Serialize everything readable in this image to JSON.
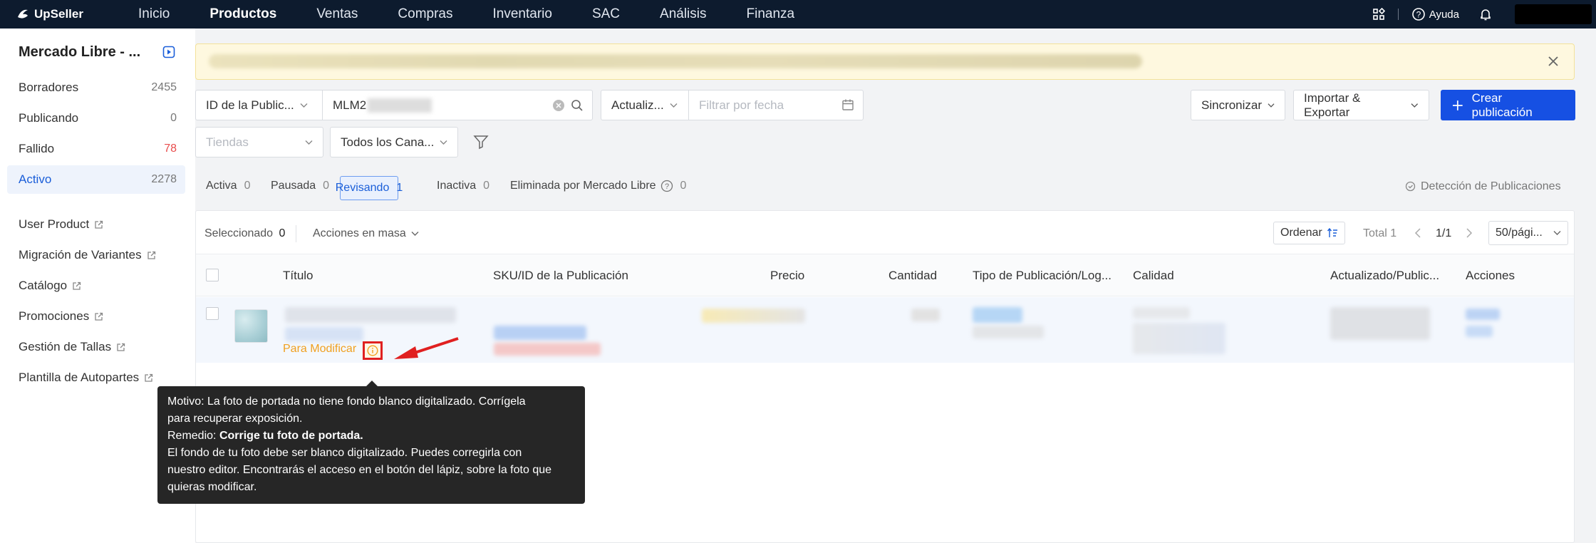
{
  "nav": {
    "logo": "UpSeller",
    "links": [
      "Inicio",
      "Productos",
      "Ventas",
      "Compras",
      "Inventario",
      "SAC",
      "Análisis",
      "Finanza"
    ],
    "help": "Ayuda"
  },
  "sidebar": {
    "store": "Mercado Libre - ...",
    "status_items": [
      {
        "label": "Borradores",
        "count": "2455"
      },
      {
        "label": "Publicando",
        "count": "0"
      },
      {
        "label": "Fallido",
        "count": "78"
      },
      {
        "label": "Activo",
        "count": "2278"
      }
    ],
    "links": [
      "User Product",
      "Migración de Variantes",
      "Catálogo",
      "Promociones",
      "Gestión de Tallas",
      "Plantilla de Autopartes"
    ]
  },
  "filters": {
    "search_type": "ID de la Public...",
    "search_value": "MLM2",
    "date_type": "Actualiz...",
    "date_placeholder": "Filtrar por fecha",
    "store_placeholder": "Tiendas",
    "channel": "Todos los Cana..."
  },
  "actions": {
    "sync": "Sincronizar",
    "import_export": "Importar & Exportar",
    "create": "Crear publicación"
  },
  "tabs": [
    {
      "label": "Activa",
      "count": "0"
    },
    {
      "label": "Pausada",
      "count": "0"
    },
    {
      "label": "Revisando",
      "count": "1"
    },
    {
      "label": "Inactiva",
      "count": "0"
    },
    {
      "label": "Eliminada por Mercado Libre",
      "count": "0"
    }
  ],
  "detection": "Detección de Publicaciones",
  "toolbar": {
    "selected_label": "Seleccionado",
    "selected_count": "0",
    "bulk": "Acciones en masa",
    "sort": "Ordenar",
    "total": "Total 1",
    "page": "1/1",
    "per_page": "50/pági..."
  },
  "columns": [
    "Título",
    "SKU/ID de la Publicación",
    "Precio",
    "Cantidad",
    "Tipo de Publicación/Log...",
    "Calidad",
    "Actualizado/Public...",
    "Acciones"
  ],
  "row": {
    "status": "Para Modificar"
  },
  "tooltip": {
    "reason_label": "Motivo:",
    "reason_line1": "La foto de portada no tiene fondo blanco digitalizado. Corrígela",
    "reason_line2": "para recuperar exposición.",
    "remedy_label": "Remedio:",
    "remedy_title": "Corrige tu foto de portada.",
    "remedy_line1": "El fondo de tu foto debe ser blanco digitalizado. Puedes corregirla con",
    "remedy_line2": "nuestro editor. Encontrarás el acceso en el botón del lápiz, sobre la foto que",
    "remedy_line3": "quieras modificar."
  },
  "colors": {
    "nav_bg": "#0d1b2e",
    "primary": "#1650e3",
    "warning": "#f0a020",
    "highlight_red": "#e02020"
  }
}
